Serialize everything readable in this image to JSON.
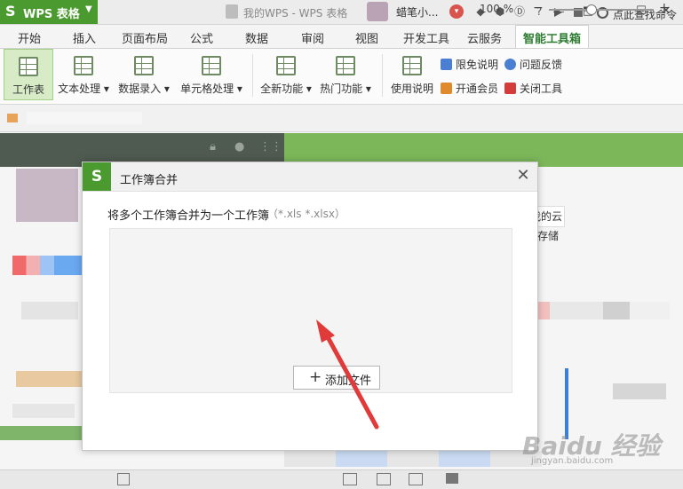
{
  "titlebar": {
    "app_logo": "S",
    "app_name": "WPS 表格",
    "app_caret": "▼",
    "doc_tab": "我的WPS - WPS 表格",
    "username": "蜡笔小...",
    "icons": [
      "wps-cloud-icon",
      "skin-icon",
      "share-icon",
      "help-icon",
      "minimize-to-tray-icon"
    ],
    "window_buttons": [
      "minimize-icon",
      "maximize-icon",
      "close-icon"
    ]
  },
  "tabs": [
    "开始",
    "插入",
    "页面布局",
    "公式",
    "数据",
    "审阅",
    "视图",
    "开发工具",
    "云服务",
    "智能工具箱"
  ],
  "active_tab": "智能工具箱",
  "ribbon": {
    "buttons": [
      {
        "label": "工作表"
      },
      {
        "label": "文本处理 ▾"
      },
      {
        "label": "数据录入 ▾"
      },
      {
        "label": "单元格处理 ▾"
      },
      {
        "label": "全新功能 ▾"
      },
      {
        "label": "热门功能 ▾"
      },
      {
        "label": "使用说明"
      }
    ],
    "small_items": [
      {
        "label": "限免说明",
        "color": "#4a7fd4"
      },
      {
        "label": "问题反馈",
        "color": "#4a7fd4"
      },
      {
        "label": "开通会员",
        "color": "#e08a2b"
      },
      {
        "label": "关闭工具",
        "color": "#d43c3c"
      }
    ]
  },
  "subbar": {
    "search_label": "点此查找命令"
  },
  "background_text": {
    "save": "我的云存储"
  },
  "dialog": {
    "logo": "S",
    "title": "工作簿合并",
    "close": "✕",
    "description": "将多个工作簿合并为一个工作簿",
    "extensions": "（*.xls *.xlsx）",
    "add_button": {
      "plus": "+",
      "label": "添加文件"
    }
  },
  "statusbar": {
    "zoom": "100 %",
    "zoom_minus": "−",
    "zoom_plus": "+",
    "zoom_level": 0.4
  },
  "watermark": {
    "text": "Baidu 经验",
    "sub": "jingyan.baidu.com"
  },
  "colors": {
    "brand_green": "#4b9a2f",
    "arrow_red": "#e03a3a"
  }
}
